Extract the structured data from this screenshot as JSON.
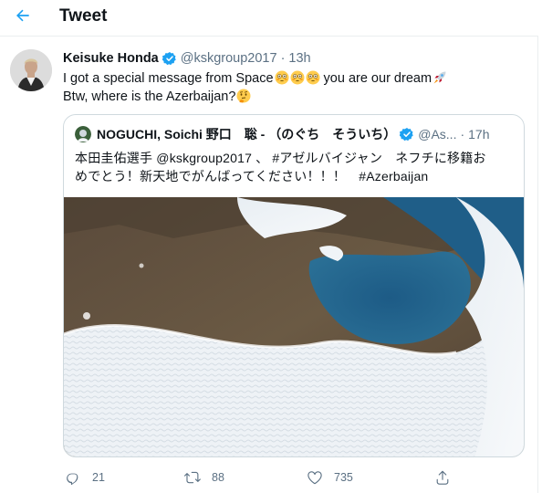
{
  "header": {
    "title": "Tweet"
  },
  "tweet": {
    "author_name": "Keisuke Honda",
    "author_handle": "@kskgroup2017",
    "separator": "·",
    "time": "13h",
    "text_line1": "I got a special message from Space",
    "text_line1_after": " you are our dream",
    "text_line2": "Btw, where is the Azerbaijan?"
  },
  "quoted_tweet": {
    "author_name": "NOGUCHI, Soichi 野口　聡 - （のぐち　そういち）",
    "author_handle": "@As...",
    "separator": "·",
    "time": "17h",
    "text_line1": "本田圭佑選手 @kskgroup2017 、 #アゼルバイジャン　ネフチに移籍お",
    "text_line2": "めでとう！新天地でがんばってください！！！　#Azerbaijan"
  },
  "actions": {
    "reply_count": "21",
    "retweet_count": "88",
    "like_count": "735"
  },
  "colors": {
    "accent": "#1da1f2",
    "secondary_text": "#5b7083",
    "border": "#cfd9de"
  },
  "icons": [
    "back-arrow-icon",
    "verified-badge-icon",
    "flushed-face-emoji",
    "rocket-emoji",
    "thinking-face-emoji",
    "reply-icon",
    "retweet-icon",
    "like-icon",
    "share-icon"
  ]
}
